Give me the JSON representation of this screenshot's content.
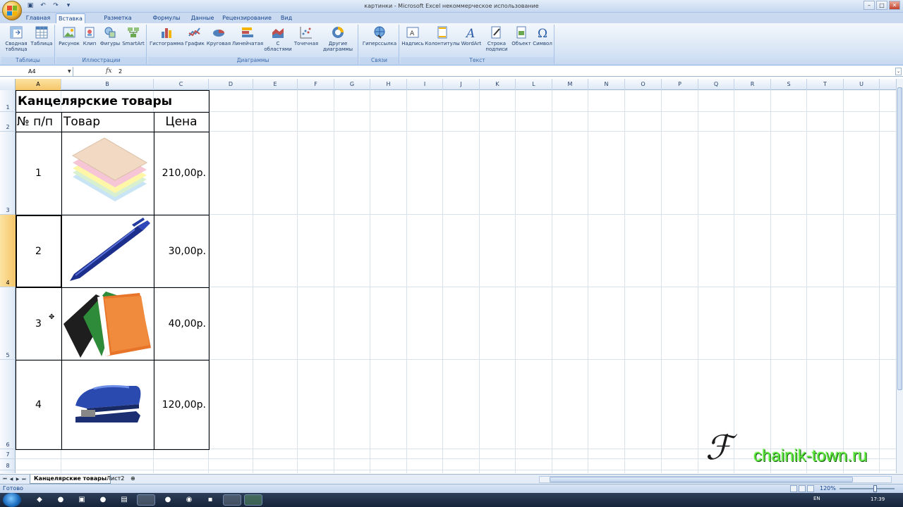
{
  "window": {
    "title": "картинки - Microsoft Excel некоммерческое использование"
  },
  "ribbon": {
    "tabs": [
      {
        "label": "Главная",
        "active": false
      },
      {
        "label": "Вставка",
        "active": true
      },
      {
        "label": "Разметка страницы",
        "active": false
      },
      {
        "label": "Формулы",
        "active": false
      },
      {
        "label": "Данные",
        "active": false
      },
      {
        "label": "Рецензирование",
        "active": false
      },
      {
        "label": "Вид",
        "active": false
      }
    ],
    "groups": {
      "tables": {
        "label": "Таблицы",
        "buttons": [
          "Сводная таблица",
          "Таблица"
        ]
      },
      "illustrations": {
        "label": "Иллюстрации",
        "buttons": [
          "Рисунок",
          "Клип",
          "Фигуры",
          "SmartArt"
        ]
      },
      "charts": {
        "label": "Диаграммы",
        "buttons": [
          "Гистограмма",
          "График",
          "Круговая",
          "Линейчатая",
          "С областями",
          "Точечная",
          "Другие диаграммы"
        ]
      },
      "links": {
        "label": "Связи",
        "buttons": [
          "Гиперссылка"
        ]
      },
      "text": {
        "label": "Текст",
        "buttons": [
          "Надпись",
          "Колонтитулы",
          "WordArt",
          "Строка подписи",
          "Объект",
          "Символ"
        ]
      }
    }
  },
  "formula_bar": {
    "name_box": "A4",
    "fx": "fx",
    "value": "2"
  },
  "grid": {
    "columns": [
      "A",
      "B",
      "C",
      "D",
      "E",
      "F",
      "G",
      "H",
      "I",
      "J",
      "K",
      "L",
      "M",
      "N",
      "O",
      "P",
      "Q",
      "R",
      "S",
      "T",
      "U"
    ],
    "rows": [
      "1",
      "2",
      "3",
      "4",
      "5",
      "6",
      "7",
      "8"
    ],
    "selected_column": "A",
    "selected_row": "4"
  },
  "sheet": {
    "title": "Канцелярские товары",
    "headers": {
      "num": "№ п/п",
      "item": "Товар",
      "price": "Цена"
    },
    "rows": [
      {
        "num": "1",
        "price": "210,00р.",
        "picture": "sticky-notes-picture"
      },
      {
        "num": "2",
        "price": "30,00р.",
        "picture": "pen-picture"
      },
      {
        "num": "3",
        "price": "40,00р.",
        "picture": "folders-picture"
      },
      {
        "num": "4",
        "price": "120,00р.",
        "picture": "stapler-picture"
      }
    ]
  },
  "sheet_tabs": [
    "Канцелярские товары",
    "Лист2"
  ],
  "status": {
    "ready": "Готово",
    "zoom": "120%"
  },
  "taskbar": {
    "lang": "EN",
    "clock": "17:39"
  },
  "watermark": {
    "text": "chainik-town.ru"
  },
  "colors": {
    "accent": "#15428b",
    "selected_header": "#f6c66a",
    "ribbon": "#dbe7f6"
  }
}
